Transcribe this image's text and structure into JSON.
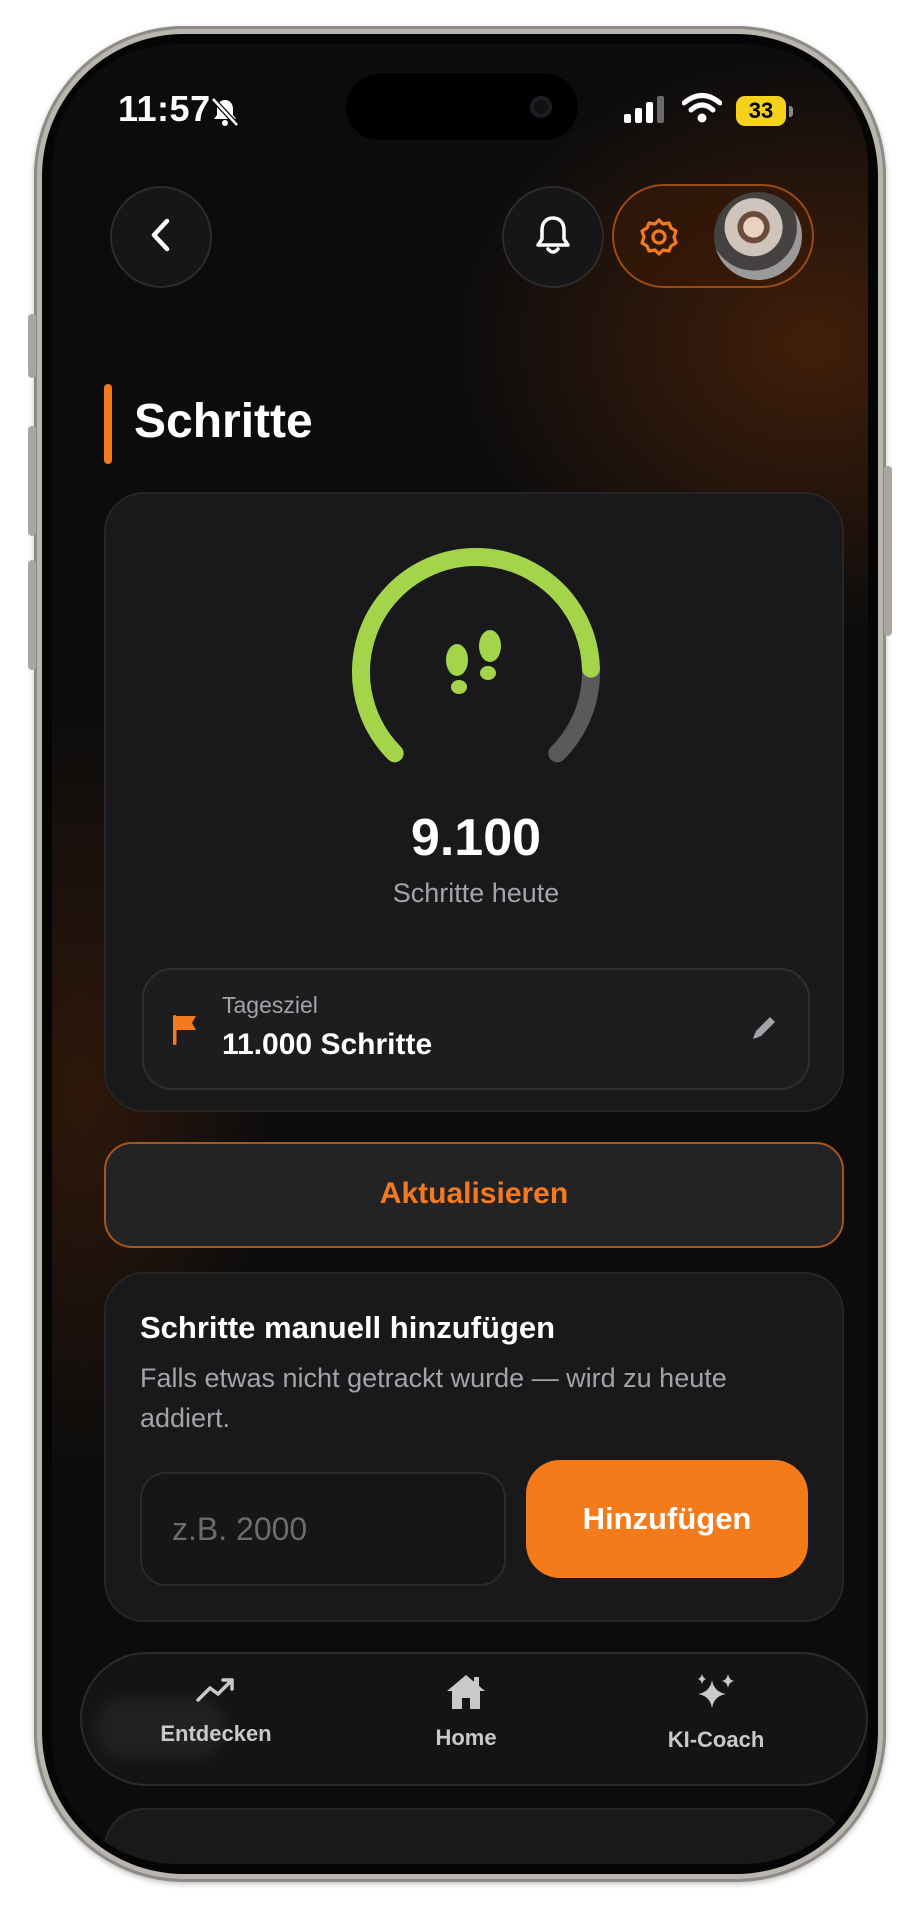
{
  "status_bar": {
    "time": "11:57",
    "battery_level": "33"
  },
  "header": {
    "back_icon": "chevron-left-icon",
    "notifications_icon": "bell-icon",
    "settings_icon": "gear-icon"
  },
  "page": {
    "title": "Schritte"
  },
  "steps_card": {
    "steps_today": "9.100",
    "steps_today_label": "Schritte heute",
    "progress_fraction": 0.827,
    "progress_color": "#a3d44a",
    "track_color": "#5a5a5c",
    "goal_label": "Tagesziel",
    "goal_value": "11.000 Schritte",
    "goal_icon": "flag-icon",
    "edit_icon": "pencil-icon"
  },
  "update_button": {
    "label": "Aktualisieren"
  },
  "manual_add": {
    "title": "Schritte manuell hinzufügen",
    "description": "Falls etwas nicht getrackt wurde — wird zu heute addiert.",
    "input_placeholder": "z.B. 2000",
    "input_value": "",
    "add_button_label": "Hinzufügen"
  },
  "tab_bar": {
    "items": [
      {
        "label": "Entdecken",
        "icon": "trending-up-icon"
      },
      {
        "label": "Home",
        "icon": "home-icon"
      },
      {
        "label": "KI-Coach",
        "icon": "sparkles-icon"
      }
    ]
  },
  "colors": {
    "accent": "#f47a1f",
    "progress": "#a3d44a"
  }
}
